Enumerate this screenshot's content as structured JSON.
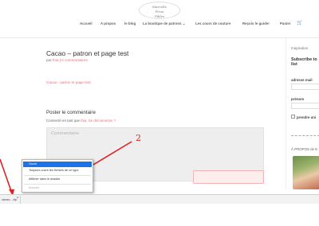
{
  "header": {
    "logo_line1": "Marcelle",
    "logo_line2": "Pirou",
    "logo_line3": "Pikles",
    "nav": [
      "Accueil",
      "A propos",
      "le blog",
      "La boutique de patrons",
      "Les cours de couture",
      "Reçois le guide!",
      "Panier"
    ],
    "nav_chevron": "⌄",
    "cart_icon": "🛒"
  },
  "post": {
    "title": "Cacao – patron et page test",
    "meta_prefix": "par",
    "author": "thia",
    "meta_separator": "|",
    "comments": "0 commentaires",
    "link": "Cacao - patron et page test"
  },
  "comment_form": {
    "title": "Poster le commentaire",
    "connected_prefix": "Connecté en tant que",
    "connected_user": "thia.",
    "logout": "Se déconnecter ?",
    "placeholder": "Commentaire"
  },
  "sidebar": {
    "inspiration": "Inspiration",
    "subscribe_line1": "Subscribe to",
    "subscribe_line2": "list",
    "email_label": "adresse mail",
    "first_name_label": "prénom",
    "read_label": "prendre uni",
    "about": "À PROPOS de E"
  },
  "annotation": {
    "number": "2"
  },
  "context_menu": {
    "items": [
      {
        "label": "Ouvrir",
        "state": "selected"
      },
      {
        "label": "Toujours ouvrir les fichiers de ce type",
        "state": "normal"
      },
      {
        "label": "Afficher dans le dossier",
        "state": "normal"
      },
      {
        "label": "Annuler",
        "state": "disabled"
      }
    ]
  },
  "download_bar": {
    "file_name": "cacao-...zip",
    "chevron": "^"
  },
  "colors": {
    "accent": "#d8777e",
    "menu_highlight": "#1a73e8",
    "annotation": "#dd2222"
  }
}
